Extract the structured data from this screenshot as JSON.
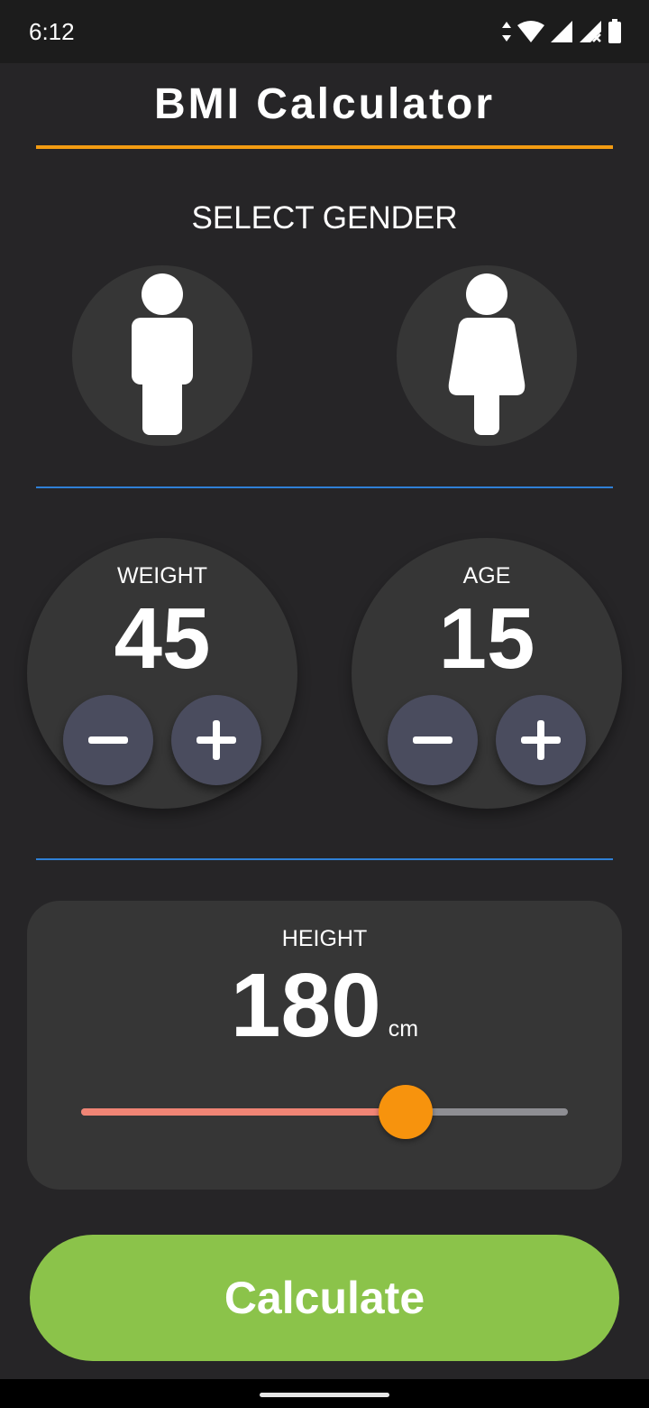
{
  "status": {
    "time": "6:12"
  },
  "app": {
    "title": "BMI Calculator"
  },
  "gender": {
    "label": "SELECT GENDER"
  },
  "weight": {
    "label": "WEIGHT",
    "value": "45"
  },
  "age": {
    "label": "AGE",
    "value": "15"
  },
  "height": {
    "label": "HEIGHT",
    "value": "180",
    "unit": "cm",
    "slider_fraction": 0.667
  },
  "calculate": {
    "label": "Calculate"
  },
  "colors": {
    "accent": "#f39c12",
    "divider": "#2f80d6",
    "button": "#8bc34a",
    "thumb": "#f7930d",
    "track_active": "#f08575"
  },
  "icons": {
    "male": "male-person-icon",
    "female": "female-person-icon",
    "minus": "minus-icon",
    "plus": "plus-icon"
  }
}
